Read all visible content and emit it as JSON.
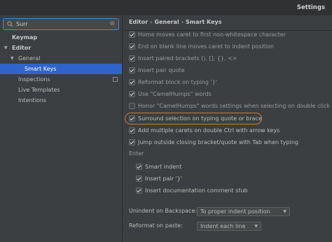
{
  "window": {
    "title": "Settings"
  },
  "search": {
    "value": "Surr"
  },
  "tree": {
    "keymap": "Keymap",
    "editor": "Editor",
    "general": "General",
    "smart_keys": "Smart Keys",
    "inspections": "Inspections",
    "live_templates": "Live Templates",
    "intentions": "Intentions"
  },
  "breadcrumb": {
    "part1": "Editor",
    "part2": "General",
    "part3": "Smart Keys",
    "separator": "›"
  },
  "options": [
    {
      "label": "Home moves caret to first non-whitespace character",
      "checked": true,
      "dim": true
    },
    {
      "label": "End on blank line moves caret to indent position",
      "checked": true,
      "dim": true
    },
    {
      "label": "Insert paired brackets (), [], {}, <>",
      "checked": true,
      "dim": true
    },
    {
      "label": "Insert pair quote",
      "checked": true,
      "dim": true
    },
    {
      "label": "Reformat block on typing '}'",
      "checked": true,
      "dim": true
    },
    {
      "label": "Use \"CamelHumps\" words",
      "checked": true,
      "dim": true
    },
    {
      "label": "Honor \"CamelHumps\" words settings when selecting on double click",
      "checked": false,
      "dim": true
    },
    {
      "label": "Surround selection on typing quote or brace",
      "checked": true,
      "dim": false
    },
    {
      "label": "Add multiple carets on double Ctrl with arrow keys",
      "checked": true,
      "dim": false
    },
    {
      "label": "Jump outside closing bracket/quote with Tab when typing",
      "checked": true,
      "dim": false
    }
  ],
  "enter": {
    "section_label": "Enter",
    "options": [
      {
        "label": "Smart indent",
        "checked": true
      },
      {
        "label": "Insert pair '}'",
        "checked": true
      },
      {
        "label": "Insert documentation comment stub",
        "checked": true
      }
    ]
  },
  "unindent": {
    "label": "Unindent on Backspace:",
    "value": "To proper indent position"
  },
  "reformat_paste": {
    "label": "Reformat on paste:",
    "value": "Indent each line"
  },
  "colors": {
    "selection": "#2f65ca",
    "highlight_ring": "#c77a32",
    "focus_border": "#4a88c7"
  }
}
